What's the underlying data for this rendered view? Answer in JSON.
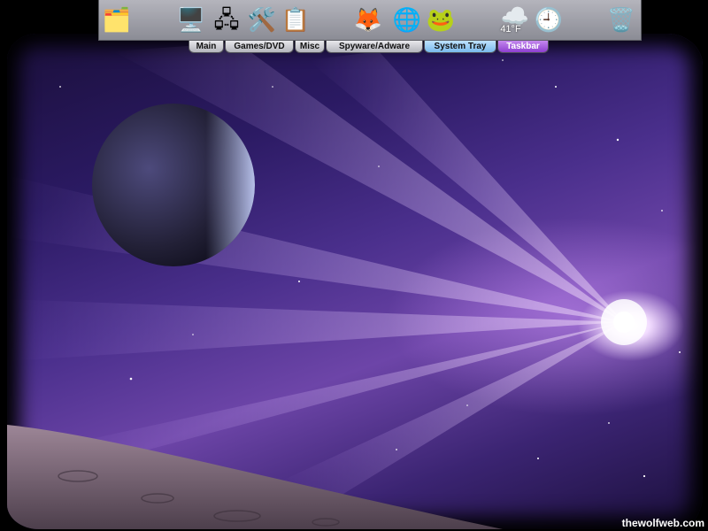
{
  "dock": {
    "icons": [
      {
        "name": "folder-apps-icon"
      },
      {
        "name": "my-computer-icon"
      },
      {
        "name": "network-icon"
      },
      {
        "name": "tools-icon"
      },
      {
        "name": "checklist-icon"
      },
      {
        "name": "firefox-icon"
      },
      {
        "name": "globe-icon"
      },
      {
        "name": "frog-icon"
      },
      {
        "name": "weather-icon"
      },
      {
        "name": "clock-icon"
      },
      {
        "name": "recycle-bin-icon"
      }
    ],
    "weather_temp": "41°F"
  },
  "tabs": [
    {
      "label": "Main"
    },
    {
      "label": "Games/DVD"
    },
    {
      "label": "Misc"
    },
    {
      "label": "Spyware/Adware"
    },
    {
      "label": "System Tray"
    },
    {
      "label": "Taskbar"
    }
  ],
  "watermark": "thewolfweb.com",
  "colors": {
    "dock": "#9e9fa7",
    "tab_system_tray": "#79b9ec",
    "tab_taskbar": "#8e3fd0",
    "space": "#2b1a63"
  }
}
